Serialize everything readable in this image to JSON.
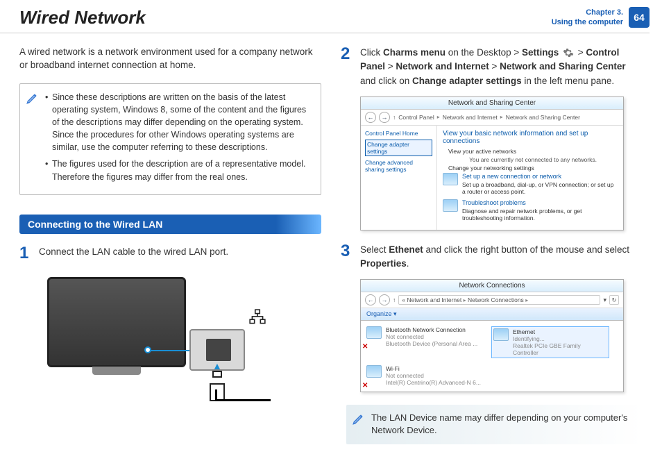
{
  "header": {
    "title": "Wired Network",
    "chapter_line1": "Chapter 3.",
    "chapter_line2": "Using the computer",
    "page_number": "64"
  },
  "intro": "A wired network is a network environment used for a company network or broadband internet connection at home.",
  "note_bullets": [
    "Since these descriptions are written on the basis of the latest operating system, Windows 8, some of the content and the figures of the descriptions may differ depending on the operating system. Since the procedures for other Windows operating systems are similar, use the computer referring to these descriptions.",
    "The figures used for the description are of a representative model. Therefore the figures may differ from the real ones."
  ],
  "section_heading": "Connecting to the Wired LAN",
  "steps": {
    "one": {
      "num": "1",
      "text": "Connect the LAN cable to the wired LAN port."
    },
    "two": {
      "num": "2",
      "pre": "Click ",
      "bold1": "Charms menu",
      "mid1": " on the Desktop > ",
      "bold2": "Settings",
      "mid2": " > ",
      "line2_bold1": "Control Panel",
      "line2_mid1": " > ",
      "line2_bold2": "Network and Internet",
      "line2_mid2": " > ",
      "line2_bold3": "Network and Sharing Center",
      "line2_mid3": " and click on ",
      "line2_bold4": "Change adapter settings",
      "line2_end": " in the left menu pane."
    },
    "three": {
      "num": "3",
      "pre": "Select ",
      "bold1": "Ethenet",
      "mid1": " and click the right button of the mouse and select ",
      "bold2": "Properties",
      "end": "."
    }
  },
  "shot1": {
    "title": "Network and Sharing Center",
    "breadcrumb": [
      "Control Panel",
      "Network and Internet",
      "Network and Sharing Center"
    ],
    "side": {
      "home": "Control Panel Home",
      "change": "Change adapter settings",
      "advanced": "Change advanced sharing settings"
    },
    "main": {
      "heading": "View your basic network information and set up connections",
      "l1": "View your active networks",
      "l1b": "You are currently not connected to any networks.",
      "l2": "Change your networking settings",
      "link1": "Set up a new connection or network",
      "link1_desc": "Set up a broadband, dial-up, or VPN connection; or set up a router or access point.",
      "link2": "Troubleshoot problems",
      "link2_desc": "Diagnose and repair network problems, or get troubleshooting information."
    }
  },
  "shot2": {
    "title": "Network Connections",
    "breadcrumb": [
      "Network and Internet",
      "Network Connections"
    ],
    "toolbar": "Organize ▾",
    "items": [
      {
        "name": "Bluetooth Network Connection",
        "status": "Not connected",
        "desc": "Bluetooth Device (Personal Area ..."
      },
      {
        "name": "Ethernet",
        "status": "Identifying...",
        "desc": "Realtek PCIe GBE Family Controller"
      },
      {
        "name": "Wi-Fi",
        "status": "Not connected",
        "desc": "Intel(R) Centrino(R) Advanced-N 6..."
      }
    ]
  },
  "tip": "The LAN Device name may differ depending on your computer's Network Device."
}
